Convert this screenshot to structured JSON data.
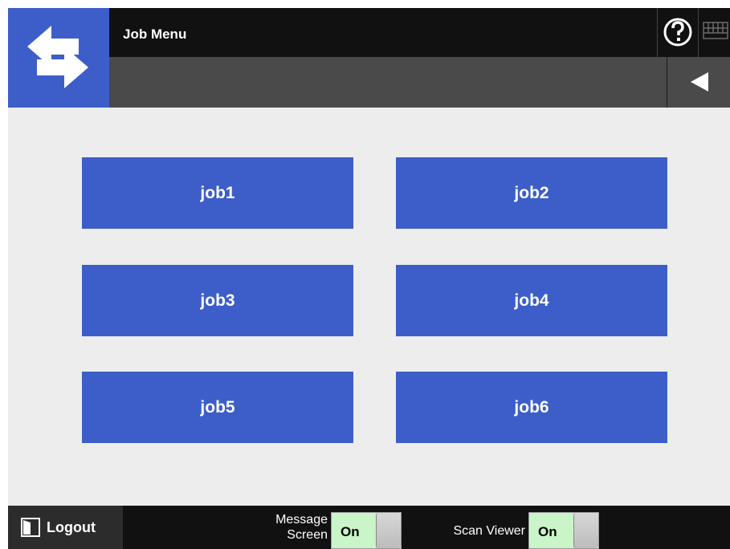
{
  "header": {
    "title": "Job Menu",
    "help_icon": "question-circle-icon",
    "keyboard_icon": "keyboard-icon",
    "back_icon": "triangle-left-icon",
    "logo_icon": "swap-arrows-icon"
  },
  "jobs": [
    "job1",
    "job2",
    "job3",
    "job4",
    "job5",
    "job6"
  ],
  "footer": {
    "logout_label": "Logout",
    "logout_icon": "logout-door-icon",
    "message_screen_label": "Message Screen",
    "message_screen_value": "On",
    "scan_viewer_label": "Scan Viewer",
    "scan_viewer_value": "On"
  },
  "colors": {
    "accent": "#3d5ec8",
    "header_bg": "#111111",
    "subheader_bg": "#4a4a4a",
    "content_bg": "#ededed",
    "toggle_on": "#c9f5c9"
  }
}
